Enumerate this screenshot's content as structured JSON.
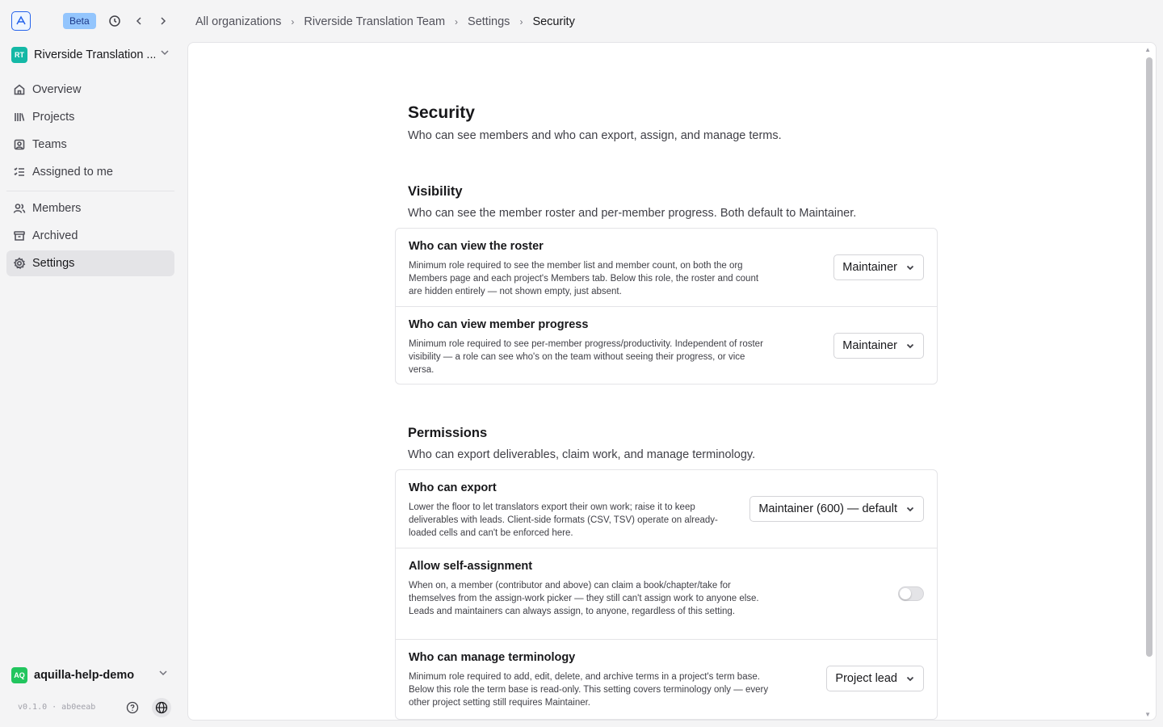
{
  "app": {
    "beta_label": "Beta",
    "org_badge": "RT",
    "org_name": "Riverside Translation ...",
    "user_badge": "AQ",
    "user_name": "aquilla-help-demo",
    "version": "v0.1.0 · ab0eeab"
  },
  "sidebar": {
    "items": [
      {
        "label": "Overview",
        "icon": "home-icon"
      },
      {
        "label": "Projects",
        "icon": "library-icon"
      },
      {
        "label": "Teams",
        "icon": "contact-icon"
      },
      {
        "label": "Assigned to me",
        "icon": "list-checks-icon"
      },
      {
        "label": "Members",
        "icon": "users-icon"
      },
      {
        "label": "Archived",
        "icon": "archive-icon"
      },
      {
        "label": "Settings",
        "icon": "gear-icon",
        "active": true
      }
    ]
  },
  "breadcrumb": [
    "All organizations",
    "Riverside Translation Team",
    "Settings",
    "Security"
  ],
  "page": {
    "title": "Security",
    "subtitle": "Who can see members and who can export, assign, and manage terms."
  },
  "visibility": {
    "title": "Visibility",
    "subtitle": "Who can see the member roster and per-member progress. Both default to Maintainer.",
    "rows": [
      {
        "title": "Who can view the roster",
        "description": "Minimum role required to see the member list and member count, on both the org Members page and each project's Members tab. Below this role, the roster and count are hidden entirely — not shown empty, just absent.",
        "value": "Maintainer"
      },
      {
        "title": "Who can view member progress",
        "description": "Minimum role required to see per-member progress/productivity. Independent of roster visibility — a role can see who's on the team without seeing their progress, or vice versa.",
        "value": "Maintainer"
      }
    ]
  },
  "permissions": {
    "title": "Permissions",
    "subtitle": "Who can export deliverables, claim work, and manage terminology.",
    "rows": [
      {
        "title": "Who can export",
        "description": "Lower the floor to let translators export their own work; raise it to keep deliverables with leads. Client-side formats (CSV, TSV) operate on already-loaded cells and can't be enforced here.",
        "value": "Maintainer (600) — default"
      },
      {
        "title": "Allow self-assignment",
        "description": "When on, a member (contributor and above) can claim a book/chapter/take for themselves from the assign-work picker — they still can't assign work to anyone else. Leads and maintainers can always assign, to anyone, regardless of this setting.",
        "toggle_on": false
      },
      {
        "title": "Who can manage terminology",
        "description": "Minimum role required to add, edit, delete, and archive terms in a project's term base. Below this role the term base is read-only. This setting covers terminology only — every other project setting still requires Maintainer.",
        "value": "Project lead"
      }
    ]
  }
}
